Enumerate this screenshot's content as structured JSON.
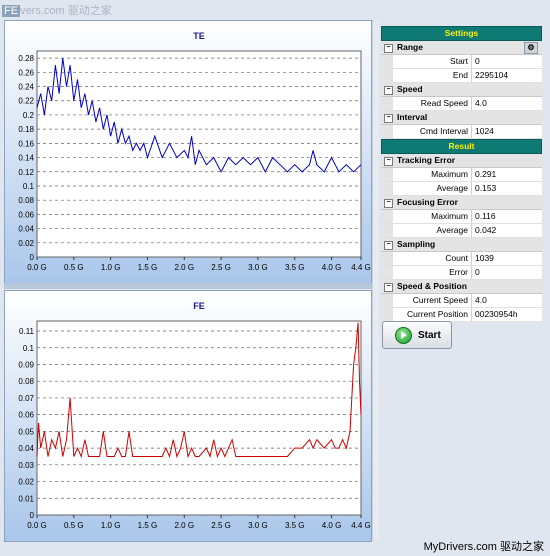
{
  "watermark": {
    "top_prefix": "FE",
    "top_rest": "vers.com  驱动之家",
    "bottom": "MyDrivers.com  驱动之家"
  },
  "chart_data": [
    {
      "type": "line",
      "title": "TE",
      "xlabel": "",
      "ylabel": "",
      "xlim": [
        0,
        4.4
      ],
      "ylim": [
        0,
        0.29
      ],
      "x_ticks": [
        "0.0 G",
        "0.5 G",
        "1.0 G",
        "1.5 G",
        "2.0 G",
        "2.5 G",
        "3.0 G",
        "3.5 G",
        "4.0 G",
        "4.4 G"
      ],
      "x_tick_values": [
        0,
        0.5,
        1.0,
        1.5,
        2.0,
        2.5,
        3.0,
        3.5,
        4.0,
        4.4
      ],
      "y_ticks": [
        "0",
        "0.02",
        "0.04",
        "0.06",
        "0.08",
        "0.1",
        "0.12",
        "0.14",
        "0.16",
        "0.18",
        "0.2",
        "0.22",
        "0.24",
        "0.26",
        "0.28"
      ],
      "y_tick_values": [
        0,
        0.02,
        0.04,
        0.06,
        0.08,
        0.1,
        0.12,
        0.14,
        0.16,
        0.18,
        0.2,
        0.22,
        0.24,
        0.26,
        0.28
      ],
      "grid": true,
      "color": "#0000cc",
      "series": [
        {
          "points": [
            [
              0.0,
              0.21
            ],
            [
              0.05,
              0.23
            ],
            [
              0.1,
              0.2
            ],
            [
              0.15,
              0.24
            ],
            [
              0.2,
              0.22
            ],
            [
              0.25,
              0.27
            ],
            [
              0.3,
              0.23
            ],
            [
              0.35,
              0.28
            ],
            [
              0.4,
              0.24
            ],
            [
              0.45,
              0.27
            ],
            [
              0.5,
              0.22
            ],
            [
              0.55,
              0.25
            ],
            [
              0.6,
              0.21
            ],
            [
              0.65,
              0.23
            ],
            [
              0.7,
              0.2
            ],
            [
              0.75,
              0.22
            ],
            [
              0.8,
              0.19
            ],
            [
              0.85,
              0.21
            ],
            [
              0.9,
              0.18
            ],
            [
              0.95,
              0.2
            ],
            [
              1.0,
              0.17
            ],
            [
              1.05,
              0.19
            ],
            [
              1.1,
              0.16
            ],
            [
              1.15,
              0.18
            ],
            [
              1.2,
              0.16
            ],
            [
              1.25,
              0.17
            ],
            [
              1.3,
              0.15
            ],
            [
              1.35,
              0.16
            ],
            [
              1.4,
              0.15
            ],
            [
              1.45,
              0.16
            ],
            [
              1.5,
              0.14
            ],
            [
              1.6,
              0.17
            ],
            [
              1.7,
              0.14
            ],
            [
              1.8,
              0.16
            ],
            [
              1.9,
              0.14
            ],
            [
              2.0,
              0.15
            ],
            [
              2.05,
              0.14
            ],
            [
              2.1,
              0.17
            ],
            [
              2.15,
              0.13
            ],
            [
              2.2,
              0.15
            ],
            [
              2.3,
              0.13
            ],
            [
              2.4,
              0.14
            ],
            [
              2.5,
              0.12
            ],
            [
              2.6,
              0.14
            ],
            [
              2.7,
              0.13
            ],
            [
              2.8,
              0.14
            ],
            [
              2.9,
              0.13
            ],
            [
              3.0,
              0.14
            ],
            [
              3.1,
              0.12
            ],
            [
              3.2,
              0.14
            ],
            [
              3.3,
              0.13
            ],
            [
              3.4,
              0.12
            ],
            [
              3.5,
              0.13
            ],
            [
              3.6,
              0.12
            ],
            [
              3.7,
              0.13
            ],
            [
              3.75,
              0.15
            ],
            [
              3.8,
              0.13
            ],
            [
              3.9,
              0.12
            ],
            [
              4.0,
              0.14
            ],
            [
              4.1,
              0.12
            ],
            [
              4.2,
              0.13
            ],
            [
              4.3,
              0.12
            ],
            [
              4.4,
              0.13
            ]
          ]
        }
      ]
    },
    {
      "type": "line",
      "title": "FE",
      "xlabel": "",
      "ylabel": "",
      "xlim": [
        0,
        4.4
      ],
      "ylim": [
        0,
        0.116
      ],
      "x_ticks": [
        "0.0 G",
        "0.5 G",
        "1.0 G",
        "1.5 G",
        "2.0 G",
        "2.5 G",
        "3.0 G",
        "3.5 G",
        "4.0 G",
        "4.4 G"
      ],
      "x_tick_values": [
        0,
        0.5,
        1.0,
        1.5,
        2.0,
        2.5,
        3.0,
        3.5,
        4.0,
        4.4
      ],
      "y_ticks": [
        "0",
        "0.01",
        "0.02",
        "0.03",
        "0.04",
        "0.05",
        "0.06",
        "0.07",
        "0.08",
        "0.09",
        "0.1",
        "0.11"
      ],
      "y_tick_values": [
        0,
        0.01,
        0.02,
        0.03,
        0.04,
        0.05,
        0.06,
        0.07,
        0.08,
        0.09,
        0.1,
        0.11
      ],
      "grid": true,
      "color": "#cc0000",
      "series": [
        {
          "points": [
            [
              0.0,
              0.035
            ],
            [
              0.02,
              0.055
            ],
            [
              0.05,
              0.04
            ],
            [
              0.1,
              0.05
            ],
            [
              0.15,
              0.035
            ],
            [
              0.2,
              0.045
            ],
            [
              0.25,
              0.04
            ],
            [
              0.3,
              0.05
            ],
            [
              0.35,
              0.035
            ],
            [
              0.4,
              0.045
            ],
            [
              0.45,
              0.07
            ],
            [
              0.5,
              0.035
            ],
            [
              0.55,
              0.04
            ],
            [
              0.6,
              0.035
            ],
            [
              0.65,
              0.045
            ],
            [
              0.7,
              0.035
            ],
            [
              0.75,
              0.035
            ],
            [
              0.8,
              0.035
            ],
            [
              0.85,
              0.035
            ],
            [
              0.9,
              0.05
            ],
            [
              0.95,
              0.035
            ],
            [
              1.0,
              0.035
            ],
            [
              1.05,
              0.035
            ],
            [
              1.1,
              0.04
            ],
            [
              1.15,
              0.035
            ],
            [
              1.2,
              0.035
            ],
            [
              1.25,
              0.05
            ],
            [
              1.3,
              0.035
            ],
            [
              1.35,
              0.035
            ],
            [
              1.4,
              0.035
            ],
            [
              1.45,
              0.035
            ],
            [
              1.5,
              0.035
            ],
            [
              1.55,
              0.035
            ],
            [
              1.6,
              0.035
            ],
            [
              1.7,
              0.035
            ],
            [
              1.75,
              0.04
            ],
            [
              1.8,
              0.035
            ],
            [
              1.85,
              0.045
            ],
            [
              1.9,
              0.035
            ],
            [
              1.95,
              0.04
            ],
            [
              2.0,
              0.05
            ],
            [
              2.05,
              0.035
            ],
            [
              2.1,
              0.04
            ],
            [
              2.15,
              0.035
            ],
            [
              2.2,
              0.035
            ],
            [
              2.3,
              0.04
            ],
            [
              2.35,
              0.035
            ],
            [
              2.4,
              0.045
            ],
            [
              2.45,
              0.035
            ],
            [
              2.5,
              0.04
            ],
            [
              2.55,
              0.035
            ],
            [
              2.6,
              0.04
            ],
            [
              2.65,
              0.045
            ],
            [
              2.7,
              0.035
            ],
            [
              2.8,
              0.035
            ],
            [
              2.9,
              0.035
            ],
            [
              3.0,
              0.035
            ],
            [
              3.1,
              0.035
            ],
            [
              3.2,
              0.035
            ],
            [
              3.3,
              0.035
            ],
            [
              3.4,
              0.035
            ],
            [
              3.5,
              0.04
            ],
            [
              3.6,
              0.04
            ],
            [
              3.7,
              0.045
            ],
            [
              3.75,
              0.04
            ],
            [
              3.8,
              0.045
            ],
            [
              3.9,
              0.04
            ],
            [
              4.0,
              0.045
            ],
            [
              4.05,
              0.04
            ],
            [
              4.1,
              0.04
            ],
            [
              4.15,
              0.045
            ],
            [
              4.2,
              0.04
            ],
            [
              4.25,
              0.05
            ],
            [
              4.3,
              0.09
            ],
            [
              4.33,
              0.1
            ],
            [
              4.36,
              0.115
            ],
            [
              4.38,
              0.08
            ],
            [
              4.4,
              0.06
            ]
          ]
        }
      ]
    }
  ],
  "settings": {
    "header": "Settings",
    "sections": [
      {
        "title": "Range",
        "rows": [
          {
            "label": "Start",
            "value": "0"
          },
          {
            "label": "End",
            "value": "2295104"
          }
        ]
      },
      {
        "title": "Speed",
        "rows": [
          {
            "label": "Read Speed",
            "value": "4.0"
          }
        ]
      },
      {
        "title": "Interval",
        "rows": [
          {
            "label": "Cmd Interval",
            "value": "1024"
          }
        ]
      }
    ]
  },
  "result": {
    "header": "Result",
    "sections": [
      {
        "title": "Tracking Error",
        "rows": [
          {
            "label": "Maximum",
            "value": "0.291"
          },
          {
            "label": "Average",
            "value": "0.153"
          }
        ]
      },
      {
        "title": "Focusing Error",
        "rows": [
          {
            "label": "Maximum",
            "value": "0.116"
          },
          {
            "label": "Average",
            "value": "0.042"
          }
        ]
      },
      {
        "title": "Sampling",
        "rows": [
          {
            "label": "Count",
            "value": "1039"
          },
          {
            "label": "Error",
            "value": "0"
          }
        ]
      },
      {
        "title": "Speed & Position",
        "rows": [
          {
            "label": "Current Speed",
            "value": "4.0"
          },
          {
            "label": "Current Position",
            "value": "00230954h"
          }
        ]
      }
    ]
  },
  "start_button": {
    "label": "Start",
    "icon": "play-icon"
  }
}
